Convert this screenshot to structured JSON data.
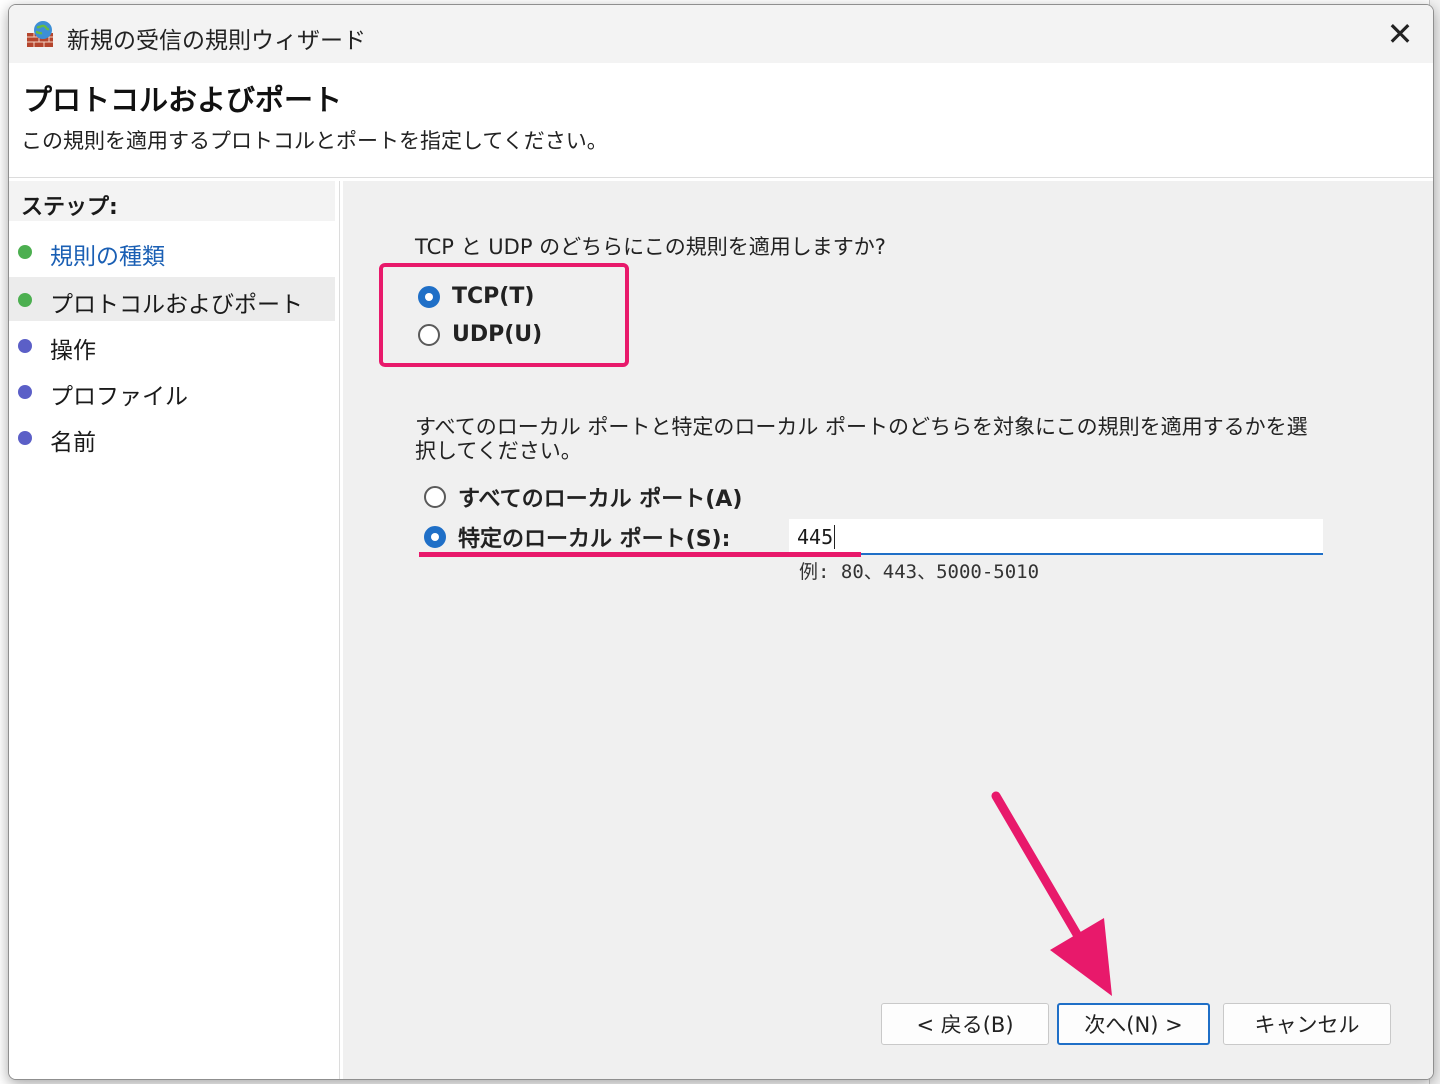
{
  "window": {
    "title": "新規の受信の規則ウィザード",
    "close_glyph": "✕"
  },
  "header": {
    "title": "プロトコルおよびポート",
    "description": "この規則を適用するプロトコルとポートを指定してください。"
  },
  "steps": {
    "heading": "ステップ:",
    "items": [
      {
        "label": "規則の種類",
        "status": "done",
        "dot_color": "#4caf50"
      },
      {
        "label": "プロトコルおよびポート",
        "status": "current",
        "dot_color": "#4caf50"
      },
      {
        "label": "操作",
        "status": "pending",
        "dot_color": "#5b5fc7"
      },
      {
        "label": "プロファイル",
        "status": "pending",
        "dot_color": "#5b5fc7"
      },
      {
        "label": "名前",
        "status": "pending",
        "dot_color": "#5b5fc7"
      }
    ]
  },
  "protocol": {
    "question": "TCP と UDP のどちらにこの規則を適用しますか?",
    "options": [
      {
        "label": "TCP(T)",
        "checked": true
      },
      {
        "label": "UDP(U)",
        "checked": false
      }
    ]
  },
  "ports": {
    "question": "すべてのローカル ポートと特定のローカル ポートのどちらを対象にこの規則を適用するかを選択してください。",
    "options": [
      {
        "label": "すべてのローカル ポート(A)",
        "checked": false
      },
      {
        "label": "特定のローカル ポート(S):",
        "checked": true
      }
    ],
    "input_value": "445",
    "hint": "例: 80、443、5000-5010"
  },
  "buttons": {
    "back": "< 戻る(B)",
    "next": "次へ(N) >",
    "cancel": "キャンセル"
  },
  "colors": {
    "accent": "#1f6fc7",
    "annotation": "#e8196b"
  }
}
